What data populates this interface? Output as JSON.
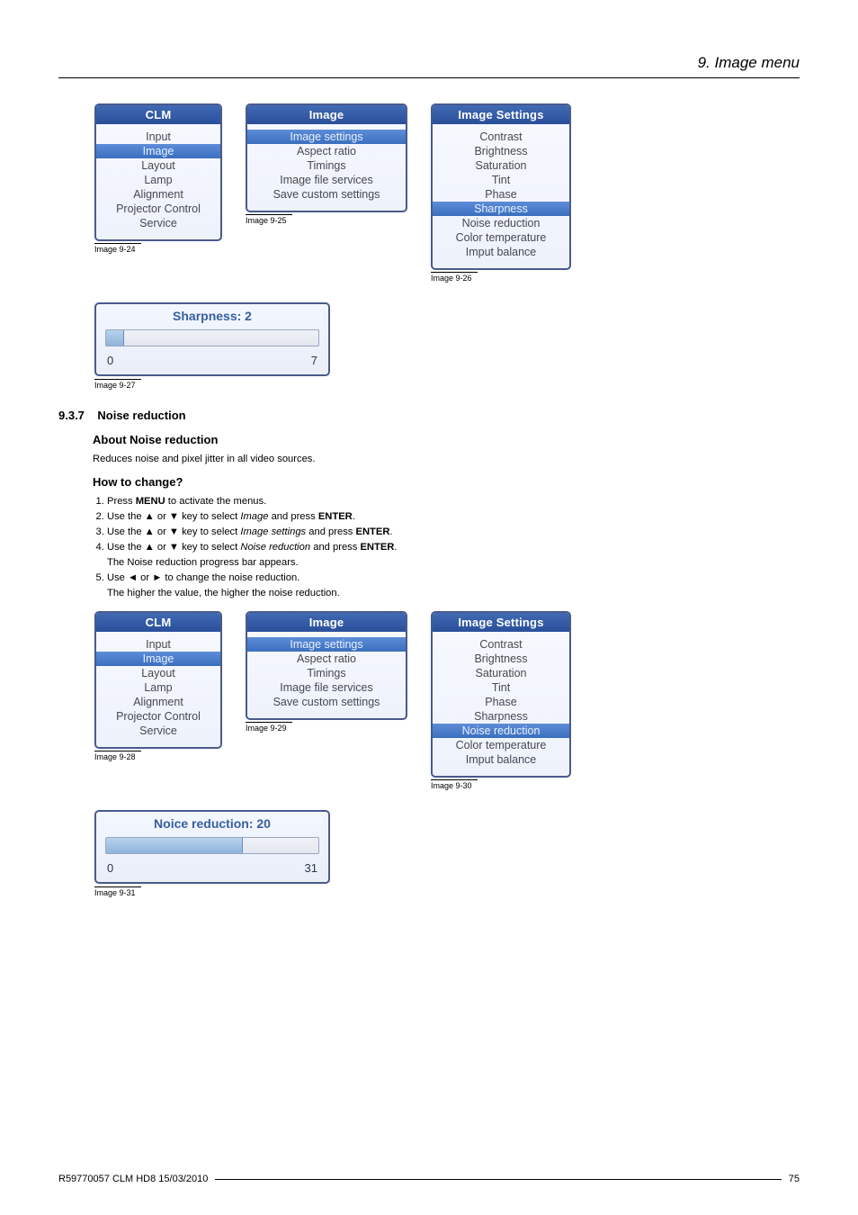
{
  "chapter_title": "9.  Image menu",
  "menus_row1": {
    "clm": {
      "title": "CLM",
      "items": [
        "Input",
        "Image",
        "Layout",
        "Lamp",
        "Alignment",
        "Projector Control",
        "Service"
      ],
      "highlight_index": 1,
      "caption": "Image 9-24"
    },
    "image": {
      "title": "Image",
      "items": [
        "Image settings",
        "Aspect ratio",
        "Timings",
        "Image file services",
        "Save custom settings"
      ],
      "highlight_index": 0,
      "caption": "Image 9-25"
    },
    "settings": {
      "title": "Image Settings",
      "items": [
        "Contrast",
        "Brightness",
        "Saturation",
        "Tint",
        "Phase",
        "Sharpness",
        "Noise reduction",
        "Color temperature",
        "Imput balance"
      ],
      "highlight_index": 5,
      "caption": "Image 9-26"
    }
  },
  "slider1": {
    "title": "Sharpness: 2",
    "min": "0",
    "max": "7",
    "fill_pct": 8,
    "caption": "Image 9-27"
  },
  "section": {
    "number": "9.3.7",
    "title": "Noise reduction",
    "about_h": "About Noise reduction",
    "about_t": "Reduces noise and pixel jitter in all video sources.",
    "how_h": "How to change?",
    "steps": [
      {
        "pre": "Press ",
        "b1": "MENU",
        "post": " to activate the menus."
      },
      {
        "pre": "Use the ▲ or ▼ key to select ",
        "i": "Image",
        "mid": " and press ",
        "b1": "ENTER",
        "post": "."
      },
      {
        "pre": "Use the ▲ or ▼ key to select ",
        "i": "Image settings",
        "mid": " and press ",
        "b1": "ENTER",
        "post": "."
      },
      {
        "pre": "Use the ▲ or ▼ key to select ",
        "i": "Noise reduction",
        "mid": " and press ",
        "b1": "ENTER",
        "post": ".",
        "sub": "The Noise reduction progress bar appears."
      },
      {
        "pre": "Use ◄ or ► to change the noise reduction.",
        "sub": "The higher the value, the higher the noise reduction."
      }
    ]
  },
  "menus_row2": {
    "clm": {
      "title": "CLM",
      "items": [
        "Input",
        "Image",
        "Layout",
        "Lamp",
        "Alignment",
        "Projector Control",
        "Service"
      ],
      "highlight_index": 1,
      "caption": "Image 9-28"
    },
    "image": {
      "title": "Image",
      "items": [
        "Image settings",
        "Aspect ratio",
        "Timings",
        "Image file services",
        "Save custom settings"
      ],
      "highlight_index": 0,
      "caption": "Image 9-29"
    },
    "settings": {
      "title": "Image Settings",
      "items": [
        "Contrast",
        "Brightness",
        "Saturation",
        "Tint",
        "Phase",
        "Sharpness",
        "Noise reduction",
        "Color temperature",
        "Imput balance"
      ],
      "highlight_index": 6,
      "caption": "Image 9-30"
    }
  },
  "slider2": {
    "title": "Noice reduction: 20",
    "min": "0",
    "max": "31",
    "fill_pct": 64,
    "caption": "Image 9-31"
  },
  "footer_left": "R59770057  CLM HD8  15/03/2010",
  "footer_right": "75"
}
